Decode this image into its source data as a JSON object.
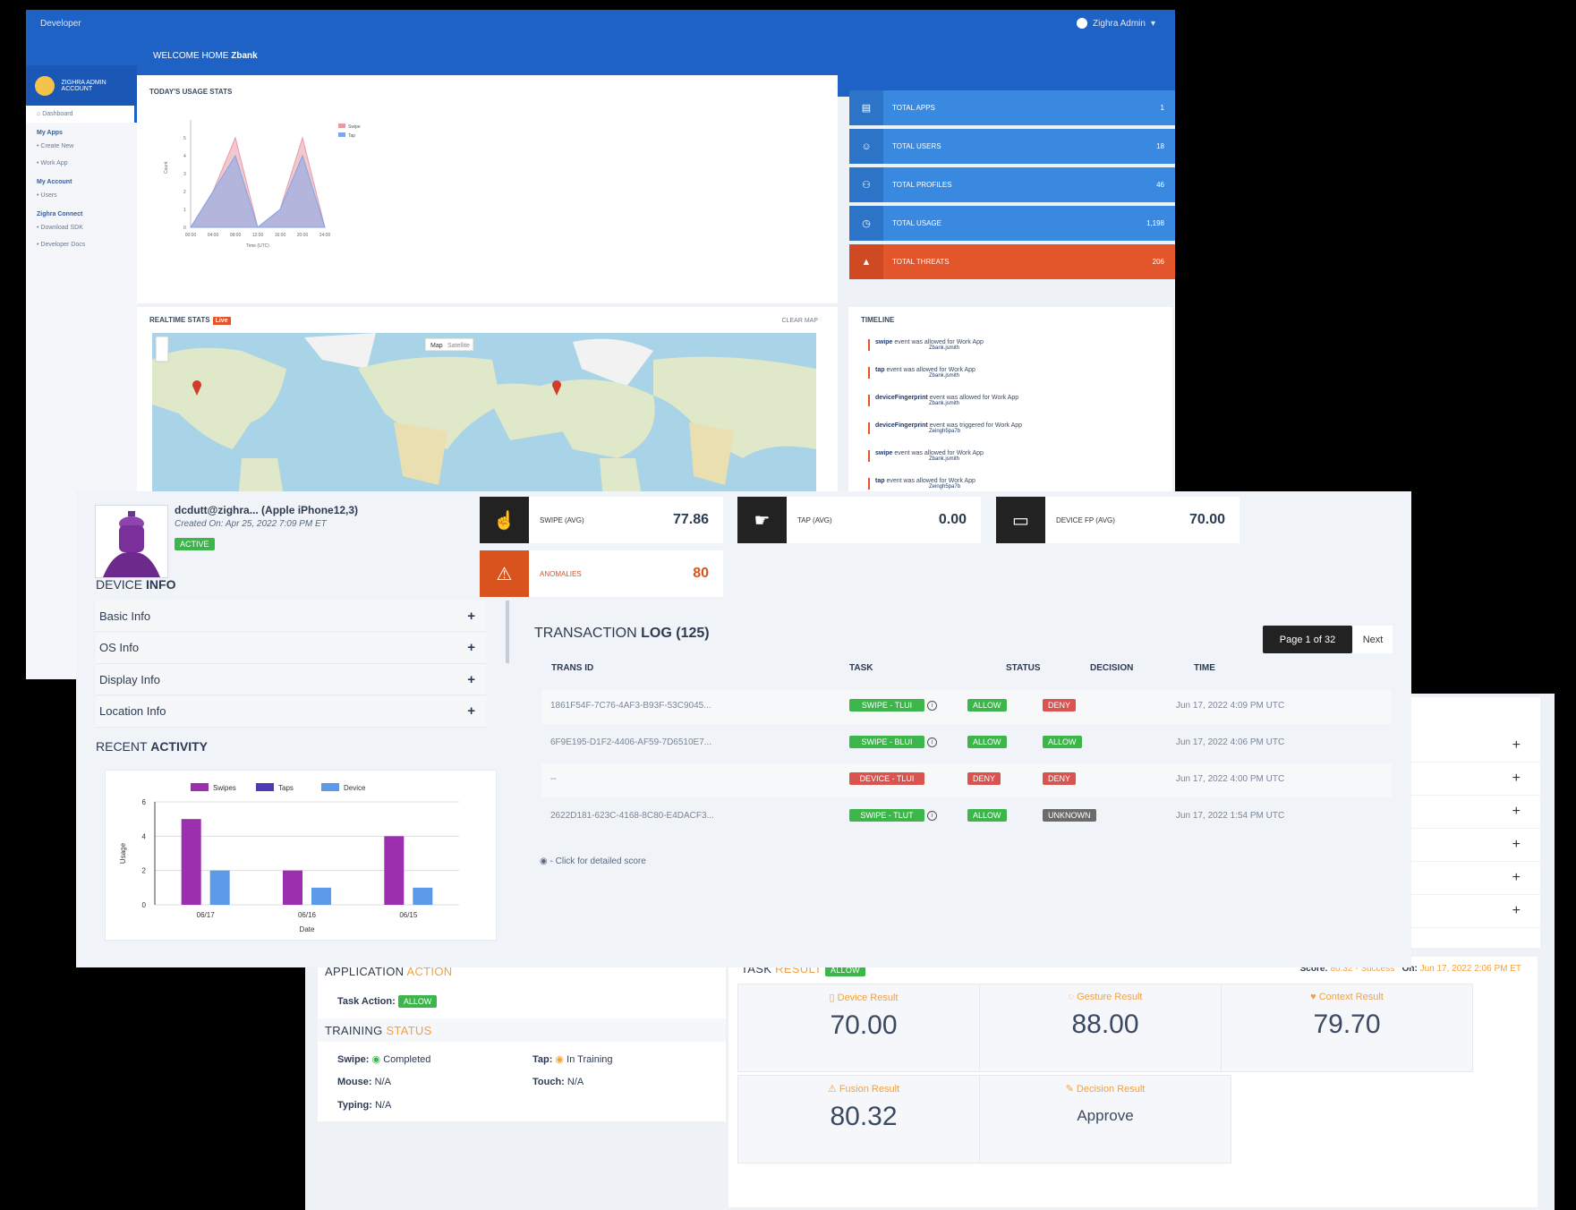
{
  "dashboard": {
    "brand": "Developer",
    "user_menu": "Zighra Admin",
    "welcome_prefix": "WELCOME HOME",
    "welcome_name": "Zbank",
    "sidebar": {
      "account_title": "ZIGHRA ADMIN ACCOUNT",
      "dashboard": "Dashboard",
      "sections": [
        {
          "title": "My Apps",
          "items": [
            "Create New",
            "Work App"
          ]
        },
        {
          "title": "My Account",
          "items": [
            "Users"
          ]
        },
        {
          "title": "Zighra Connect",
          "items": [
            "Download SDK",
            "Developer Docs"
          ]
        }
      ]
    },
    "usage_title": "TODAY'S USAGE STATS",
    "stats": [
      {
        "icon": "apps-icon",
        "glyph": "▤",
        "label": "TOTAL APPS",
        "value": "1",
        "color": "#3a89e0"
      },
      {
        "icon": "users-icon",
        "glyph": "☺",
        "label": "TOTAL USERS",
        "value": "18",
        "color": "#3a89e0"
      },
      {
        "icon": "profiles-icon",
        "glyph": "⚇",
        "label": "TOTAL PROFILES",
        "value": "46",
        "color": "#3a89e0"
      },
      {
        "icon": "usage-icon",
        "glyph": "◷",
        "label": "TOTAL USAGE",
        "value": "1,198",
        "color": "#3a89e0"
      },
      {
        "icon": "threats-icon",
        "glyph": "▲",
        "label": "TOTAL THREATS",
        "value": "206",
        "color": "#e3552a"
      }
    ],
    "realtime_title": "REALTIME STATS",
    "realtime_badge": "Live",
    "clear_label": "CLEAR MAP",
    "map_tabs": [
      "Map",
      "Satellite"
    ],
    "timeline_title": "TIMELINE",
    "timeline": [
      {
        "event": "swipe",
        "text": "event was allowed for",
        "app": "Work App",
        "user": "Zbank.jsmith"
      },
      {
        "event": "tap",
        "text": "event was allowed for",
        "app": "Work App",
        "user": "Zbank.jsmith"
      },
      {
        "event": "deviceFingerprint",
        "text": "event was allowed for",
        "app": "Work App",
        "user": "Zbank.jsmith"
      },
      {
        "event": "deviceFingerprint",
        "text": "event was triggered for",
        "app": "Work App",
        "user": "Zeingh5pa7b"
      },
      {
        "event": "swipe",
        "text": "event was allowed for",
        "app": "Work App",
        "user": "Zbank.jsmith"
      },
      {
        "event": "tap",
        "text": "event was allowed for",
        "app": "Work App",
        "user": "Zeingh5pa7b"
      }
    ]
  },
  "device": {
    "name": "dcdutt@zighra... (Apple iPhone12,3)",
    "created": "Created On: Apr 25, 2022 7:09 PM ET",
    "status": "ACTIVE",
    "info_title_light": "DEVICE",
    "info_title_bold": "INFO",
    "accordion": [
      "Basic Info",
      "OS Info",
      "Display Info",
      "Location Info"
    ],
    "recent_light": "RECENT",
    "recent_bold": "ACTIVITY",
    "kpis": [
      {
        "icon": "swipe-icon",
        "glyph": "☝",
        "label": "SWIPE (AVG)",
        "value": "77.86"
      },
      {
        "icon": "tap-icon",
        "glyph": "☛",
        "label": "TAP (AVG)",
        "value": "0.00"
      },
      {
        "icon": "device-fp-icon",
        "glyph": "▭",
        "label": "DEVICE FP (AVG)",
        "value": "70.00"
      },
      {
        "icon": "anomalies-icon",
        "glyph": "⚠",
        "label": "ANOMALIES",
        "value": "80"
      }
    ],
    "tx_title_light": "TRANSACTION",
    "tx_title_bold": "LOG (125)",
    "pager_current": "Page 1 of 32",
    "pager_next": "Next",
    "tx_headers": [
      "TRANS ID",
      "TASK",
      "STATUS",
      "DECISION",
      "TIME"
    ],
    "tx_rows": [
      {
        "id": "1861F54F-7C76-4AF3-B93F-53C9045...",
        "task": "SWIPE - TLUI",
        "task_color": "green",
        "status": "ALLOW",
        "status_color": "green",
        "decision": "DENY",
        "decision_color": "red",
        "time": "Jun 17, 2022 4:09 PM UTC"
      },
      {
        "id": "6F9E195-D1F2-4406-AF59-7D6510E7...",
        "task": "SWIPE - BLUI",
        "task_color": "green",
        "status": "ALLOW",
        "status_color": "green",
        "decision": "ALLOW",
        "decision_color": "green",
        "time": "Jun 17, 2022 4:06 PM UTC"
      },
      {
        "id": "--",
        "task": "DEVICE - TLUI",
        "task_color": "red",
        "status": "DENY",
        "status_color": "red",
        "decision": "DENY",
        "decision_color": "red",
        "time": "Jun 17, 2022 4:00 PM UTC"
      },
      {
        "id": "2622D181-623C-4168-8C80-E4DACF3...",
        "task": "SWIPE - TLUT",
        "task_color": "green",
        "status": "ALLOW",
        "status_color": "green",
        "decision": "UNKNOWN",
        "decision_color": "gray",
        "time": "Jun 17, 2022 1:54 PM UTC"
      }
    ],
    "tx_footer": "- Click for detailed score"
  },
  "result": {
    "app_action_light": "APPLICATION",
    "app_action_bold": "ACTION",
    "task_action_label": "Task Action:",
    "task_action_value": "ALLOW",
    "training_light": "TRAINING",
    "training_bold": "STATUS",
    "training": {
      "swipe_label": "Swipe:",
      "swipe_value": "Completed",
      "tap_label": "Tap:",
      "tap_value": "In Training",
      "mouse_label": "Mouse:",
      "mouse_value": "N/A",
      "touch_label": "Touch:",
      "touch_value": "N/A",
      "typing_label": "Typing:",
      "typing_value": "N/A"
    },
    "task_light": "TASK",
    "task_bold": "RESULT",
    "task_badge": "ALLOW",
    "score_label": "Score:",
    "score_value": "80.32 - Success",
    "on_label": "On:",
    "on_value": "Jun 17, 2022 2:06 PM ET",
    "boxes": [
      {
        "label": "Device Result",
        "value": "70.00"
      },
      {
        "label": "Gesture Result",
        "value": "88.00"
      },
      {
        "label": "Context Result",
        "value": "79.70"
      },
      {
        "label": "Fusion Result",
        "value": "80.32"
      },
      {
        "label": "Decision Result",
        "value": "Approve"
      }
    ],
    "plus_rows": 6
  },
  "chart_data": [
    {
      "type": "area",
      "title": "",
      "xlabel": "Time (UTC)",
      "ylabel": "Count",
      "x": [
        "00:00",
        "04:00",
        "08:00",
        "12:00",
        "16:00",
        "20:00",
        "24:00"
      ],
      "series": [
        {
          "name": "Swipe",
          "values": [
            0,
            2,
            5,
            0,
            1,
            5,
            0
          ]
        },
        {
          "name": "Tap",
          "values": [
            0,
            2,
            4,
            0,
            1,
            4,
            0
          ]
        }
      ],
      "ylim": [
        0,
        6
      ],
      "grid": false,
      "legend": "top-right"
    },
    {
      "type": "bar",
      "title": "",
      "xlabel": "Date",
      "ylabel": "Usage",
      "categories": [
        "06/17",
        "06/16",
        "06/15"
      ],
      "series": [
        {
          "name": "Swipes",
          "values": [
            5,
            2,
            4
          ],
          "color": "#9b2fae"
        },
        {
          "name": "Taps",
          "values": [
            0,
            0,
            0
          ],
          "color": "#4b3bb5"
        },
        {
          "name": "Device",
          "values": [
            2,
            1,
            1
          ],
          "color": "#5b9ae6"
        }
      ],
      "ylim": [
        0,
        6
      ],
      "yticks": [
        0,
        2,
        4,
        6
      ],
      "grid": true,
      "legend": "top"
    }
  ]
}
